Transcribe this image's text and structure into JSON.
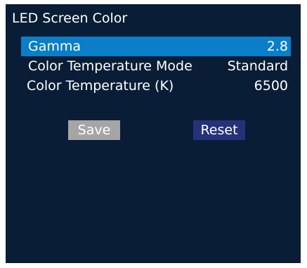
{
  "screen": {
    "title": "LED Screen Color"
  },
  "settings": [
    {
      "label": "Gamma",
      "value": "2.8",
      "selected": true
    },
    {
      "label": "Color Temperature Mode",
      "value": "Standard",
      "selected": false
    },
    {
      "label": "Color Temperature (K)",
      "value": "6500",
      "selected": false
    }
  ],
  "buttons": {
    "save_label": "Save",
    "reset_label": "Reset"
  },
  "colors": {
    "panel_background": "#091d36",
    "selected_row": "#0a7ec8",
    "save_button": "#a5a5a5",
    "reset_button": "#25327a",
    "text": "#ffffff"
  }
}
